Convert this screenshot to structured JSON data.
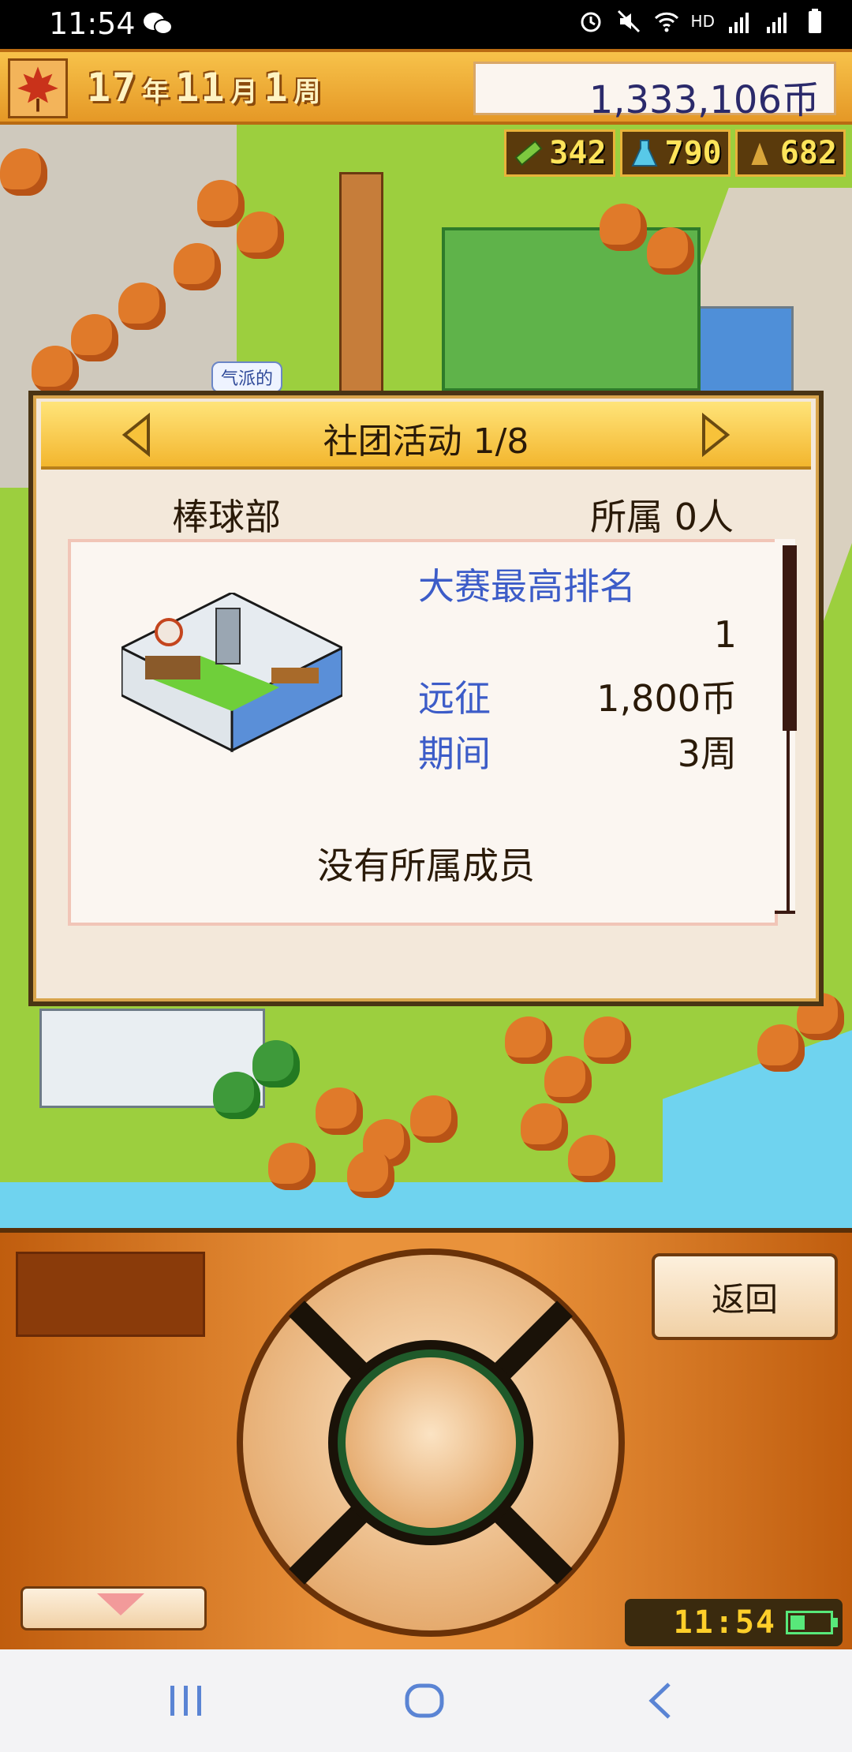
{
  "status_bar": {
    "time": "11:54",
    "network_label": "HD",
    "icons": [
      "wechat-icon",
      "alarm-icon",
      "mute-icon",
      "wifi-icon",
      "signal-4g-icon",
      "signal-3g-icon",
      "battery-icon"
    ]
  },
  "hud": {
    "year": "17",
    "year_unit": "年",
    "month": "11",
    "month_unit": "月",
    "week": "1",
    "week_unit": "周",
    "money": "1,333,106币",
    "stats": [
      {
        "icon": "pencil-icon",
        "value": "342"
      },
      {
        "icon": "flask-icon",
        "value": "790"
      },
      {
        "icon": "trophy-icon",
        "value": "682"
      }
    ]
  },
  "map": {
    "bubble_label": "气派的"
  },
  "dialog": {
    "title": "社团活动 1/8",
    "club_name": "棒球部",
    "members": "所属 0人",
    "tournament_label": "大赛最高排名",
    "tournament_value": "1",
    "expedition_label": "远征",
    "expedition_value": "1,800币",
    "period_label": "期间",
    "period_value": "3周",
    "no_members": "没有所属成员"
  },
  "panel": {
    "back_label": "返回",
    "clock": "11:54"
  },
  "colors": {
    "accent_blue": "#3c5cc8",
    "hud_orange": "#e59826",
    "panel_orange": "#e9923b"
  }
}
